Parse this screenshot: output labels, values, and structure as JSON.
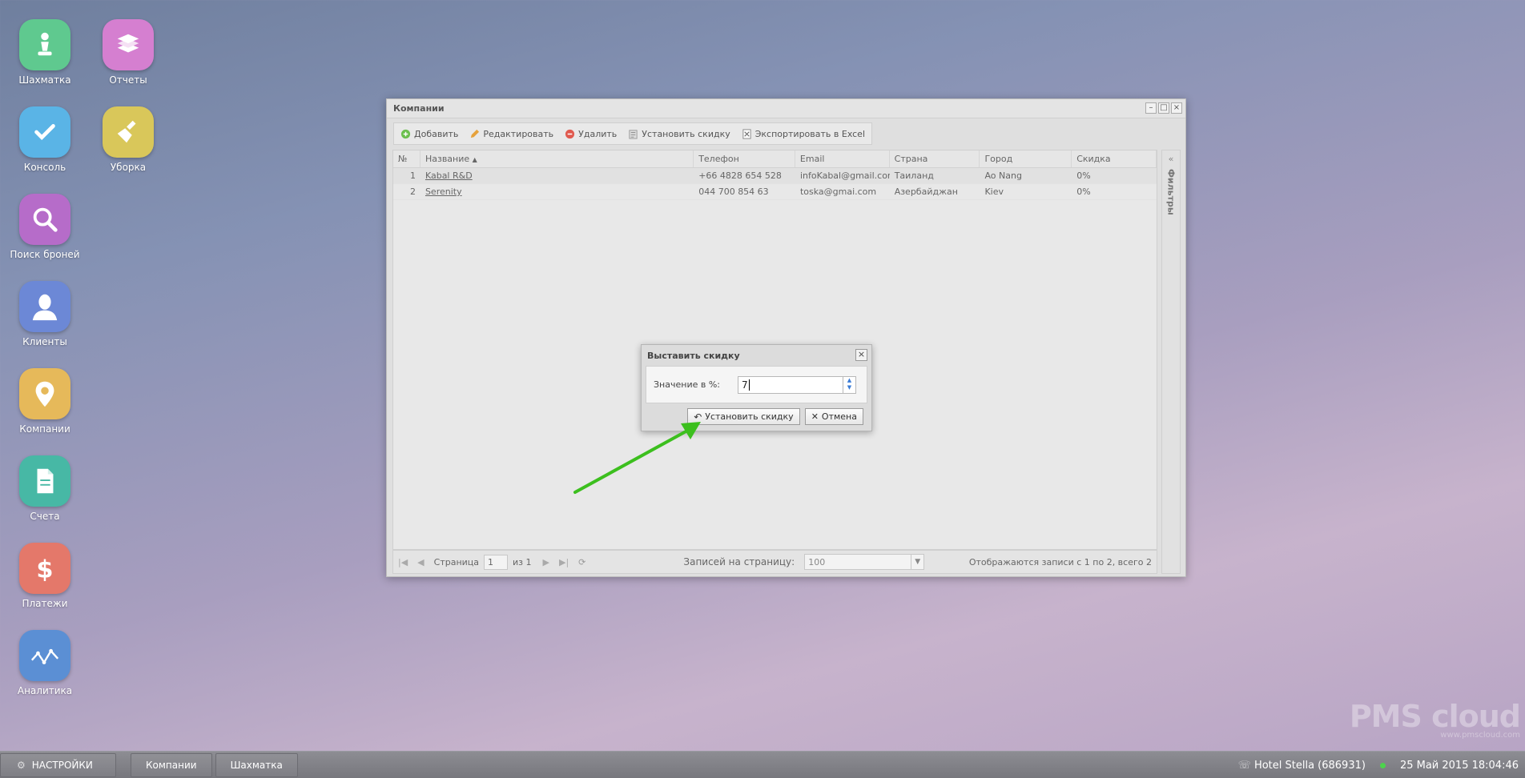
{
  "desktop": {
    "icons": [
      {
        "label": "Шахматка",
        "color": "#5fc98f",
        "icon": "chess-pawn-icon"
      },
      {
        "label": "Отчеты",
        "color": "#d57fd0",
        "icon": "books-icon"
      },
      {
        "label": "Консоль",
        "color": "#5ab4e6",
        "icon": "check-icon"
      },
      {
        "label": "Уборка",
        "color": "#d9c75a",
        "icon": "broom-icon"
      },
      {
        "label": "Поиск броней",
        "color": "#b66cc9",
        "icon": "magnifier-icon"
      },
      {
        "label": "Клиенты",
        "color": "#6c88d6",
        "icon": "person-icon"
      },
      {
        "label": "Компании",
        "color": "#e6b95a",
        "icon": "location-pin-icon"
      },
      {
        "label": "Счета",
        "color": "#47b8a5",
        "icon": "document-icon"
      },
      {
        "label": "Платежи",
        "color": "#e4786a",
        "icon": "dollar-icon"
      },
      {
        "label": "Аналитика",
        "color": "#5b8fd4",
        "icon": "line-chart-icon"
      }
    ]
  },
  "window": {
    "title": "Компании",
    "toolbar": {
      "add": "Добавить",
      "edit": "Редактировать",
      "delete": "Удалить",
      "set_discount": "Установить скидку",
      "export": "Экспортировать в Excel"
    },
    "columns": {
      "num": "№",
      "name": "Название",
      "phone": "Телефон",
      "email": "Email",
      "country": "Страна",
      "city": "Город",
      "discount": "Скидка"
    },
    "rows": [
      {
        "num": "1",
        "name": "Kabal R&D",
        "phone": "+66 4828 654 528",
        "email": "infoKabal@gmail.com",
        "country": "Таиланд",
        "city": "Ao Nang",
        "discount": "0%"
      },
      {
        "num": "2",
        "name": "Serenity",
        "phone": "044 700 854 63",
        "email": "toska@gmai.com",
        "country": "Азербайджан",
        "city": "Kiev",
        "discount": "0%"
      }
    ],
    "filters_label": "Фильтры",
    "pager": {
      "page_label": "Страница",
      "page_value": "1",
      "of_label": "из 1",
      "per_page_label": "Записей на страницу:",
      "per_page_value": "100",
      "summary": "Отображаются записи с 1 по 2, всего 2"
    }
  },
  "dialog": {
    "title": "Выставить скидку",
    "field_label": "Значение в %:",
    "field_value": "7",
    "ok_label": "Установить скидку",
    "cancel_label": "Отмена"
  },
  "taskbar": {
    "settings": "НАСТРОЙКИ",
    "tabs": [
      "Компании",
      "Шахматка"
    ],
    "hotel": "Hotel Stella (686931)",
    "datetime": "25 Май 2015 18:04:46"
  },
  "watermark": {
    "logo": "PMS cloud",
    "url": "www.pmscloud.com"
  },
  "accent_arrow_color": "#3cbf1e"
}
